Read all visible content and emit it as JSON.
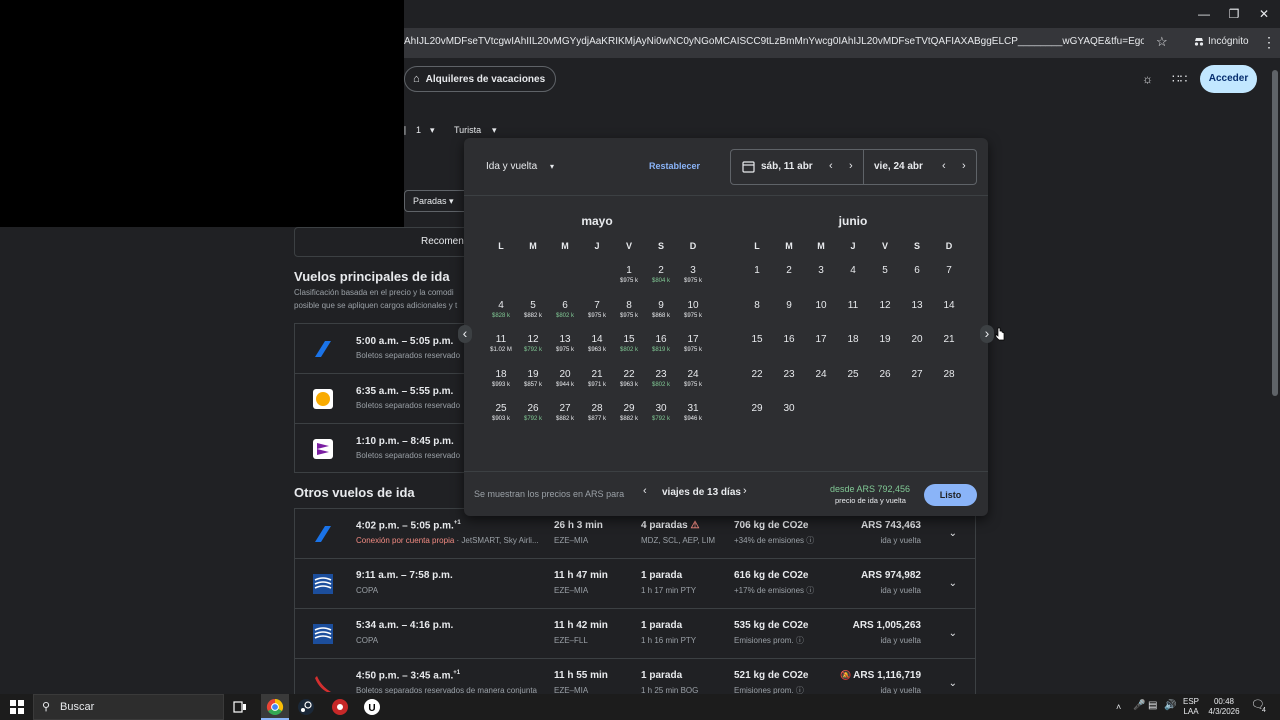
{
  "browser": {
    "url": "AhIJL20vMDFseTVtcgwIAhIIL20vMGYydjAaKRIKMjAyNi0wNC0yNGoMCAISCC9tLzBmMnYwcg0IAhIJL20vMDFseTVtQAFIAXABggELCP________wGYAQE&tfu=EgoIABAAGAAgAigB&...",
    "incognito_label": "Incógnito"
  },
  "header": {
    "chip_label": "Alquileres de vacaciones",
    "signin_label": "Acceder"
  },
  "filters": {
    "passengers": "1",
    "class": "Turista",
    "stops": "Paradas",
    "recommended": "Recomen"
  },
  "top_flights": {
    "title": "Vuelos principales de ida",
    "subtitle_1": "Clasificación basada en el precio y la comodi",
    "subtitle_2": "posible que se apliquen cargos adicionales y t",
    "rows": [
      {
        "time": "5:00 a.m. – 5:05 p.m.",
        "airline": "Boletos separados reservado",
        "logo_color": "#1a73e8"
      },
      {
        "time": "6:35 a.m. – 5:55 p.m.",
        "airline": "Boletos separados reservado",
        "logo_color": "#f9ab00"
      },
      {
        "time": "1:10 p.m. – 8:45 p.m.",
        "airline": "Boletos separados reservado",
        "logo_color": "#7b1fa2"
      }
    ]
  },
  "other_flights": {
    "title": "Otros vuelos de ida",
    "rows": [
      {
        "time": "4:02 p.m. – 5:05 p.m.",
        "plus": "+1",
        "airline": "Conexión por cuenta propia",
        "airline_extra": " · JetSMART, Sky Airli...",
        "duration": "26 h 3 min",
        "route": "EZE–MIA",
        "stops": "4 paradas",
        "stops_detail": "MDZ, SCL, AEP, LIM",
        "co2": "706 kg de CO2e",
        "co2_detail": "+34% de emisiones",
        "price": "ARS 743,463",
        "price_note": "ida y vuelta"
      },
      {
        "time": "9:11 a.m. – 7:58 p.m.",
        "plus": "",
        "airline": "COPA",
        "airline_extra": "",
        "duration": "11 h 47 min",
        "route": "EZE–MIA",
        "stops": "1 parada",
        "stops_detail": "1 h 17 min PTY",
        "co2": "616 kg de CO2e",
        "co2_detail": "+17% de emisiones",
        "price": "ARS 974,982",
        "price_note": "ida y vuelta"
      },
      {
        "time": "5:34 a.m. – 4:16 p.m.",
        "plus": "",
        "airline": "COPA",
        "airline_extra": "",
        "duration": "11 h 42 min",
        "route": "EZE–FLL",
        "stops": "1 parada",
        "stops_detail": "1 h 16 min PTY",
        "co2": "535 kg de CO2e",
        "co2_detail": "Emisiones prom.",
        "price": "ARS 1,005,263",
        "price_note": "ida y vuelta"
      },
      {
        "time": "4:50 p.m. – 3:45 a.m.",
        "plus": "+1",
        "airline": "Boletos separados reservados de manera conjunta",
        "airline_extra": "",
        "duration": "11 h 55 min",
        "route": "EZE–MIA",
        "stops": "1 parada",
        "stops_detail": "1 h 25 min BOG",
        "co2": "521 kg de CO2e",
        "co2_detail": "Emisiones prom.",
        "price": "ARS 1,116,719",
        "price_note": "ida y vuelta"
      }
    ]
  },
  "calendar": {
    "trip_type": "Ida y vuelta",
    "reset_label": "Restablecer",
    "depart_date": "sáb, 11 abr",
    "return_date": "vie, 24 abr",
    "weekdays": [
      "L",
      "M",
      "M",
      "J",
      "V",
      "S",
      "D"
    ],
    "months": [
      {
        "name": "mayo",
        "offset": 4,
        "days": [
          {
            "d": "1",
            "p": "$975 k",
            "low": false
          },
          {
            "d": "2",
            "p": "$804 k",
            "low": true
          },
          {
            "d": "3",
            "p": "$975 k",
            "low": false
          },
          {
            "d": "4",
            "p": "$828 k",
            "low": true
          },
          {
            "d": "5",
            "p": "$882 k",
            "low": false
          },
          {
            "d": "6",
            "p": "$802 k",
            "low": true
          },
          {
            "d": "7",
            "p": "$975 k",
            "low": false
          },
          {
            "d": "8",
            "p": "$975 k",
            "low": false
          },
          {
            "d": "9",
            "p": "$868 k",
            "low": false
          },
          {
            "d": "10",
            "p": "$975 k",
            "low": false
          },
          {
            "d": "11",
            "p": "$1.02 M",
            "low": false
          },
          {
            "d": "12",
            "p": "$792 k",
            "low": true
          },
          {
            "d": "13",
            "p": "$975 k",
            "low": false
          },
          {
            "d": "14",
            "p": "$963 k",
            "low": false
          },
          {
            "d": "15",
            "p": "$802 k",
            "low": true
          },
          {
            "d": "16",
            "p": "$819 k",
            "low": true
          },
          {
            "d": "17",
            "p": "$975 k",
            "low": false
          },
          {
            "d": "18",
            "p": "$993 k",
            "low": false
          },
          {
            "d": "19",
            "p": "$857 k",
            "low": false
          },
          {
            "d": "20",
            "p": "$944 k",
            "low": false
          },
          {
            "d": "21",
            "p": "$971 k",
            "low": false
          },
          {
            "d": "22",
            "p": "$963 k",
            "low": false
          },
          {
            "d": "23",
            "p": "$802 k",
            "low": true
          },
          {
            "d": "24",
            "p": "$975 k",
            "low": false
          },
          {
            "d": "25",
            "p": "$903 k",
            "low": false
          },
          {
            "d": "26",
            "p": "$792 k",
            "low": true
          },
          {
            "d": "27",
            "p": "$882 k",
            "low": false
          },
          {
            "d": "28",
            "p": "$877 k",
            "low": false
          },
          {
            "d": "29",
            "p": "$882 k",
            "low": false
          },
          {
            "d": "30",
            "p": "$792 k",
            "low": true
          },
          {
            "d": "31",
            "p": "$946 k",
            "low": false
          }
        ]
      },
      {
        "name": "junio",
        "offset": 0,
        "days": [
          {
            "d": "1"
          },
          {
            "d": "2"
          },
          {
            "d": "3"
          },
          {
            "d": "4"
          },
          {
            "d": "5"
          },
          {
            "d": "6"
          },
          {
            "d": "7"
          },
          {
            "d": "8"
          },
          {
            "d": "9"
          },
          {
            "d": "10"
          },
          {
            "d": "11"
          },
          {
            "d": "12"
          },
          {
            "d": "13"
          },
          {
            "d": "14"
          },
          {
            "d": "15"
          },
          {
            "d": "16"
          },
          {
            "d": "17"
          },
          {
            "d": "18"
          },
          {
            "d": "19"
          },
          {
            "d": "20"
          },
          {
            "d": "21"
          },
          {
            "d": "22"
          },
          {
            "d": "23"
          },
          {
            "d": "24"
          },
          {
            "d": "25"
          },
          {
            "d": "26"
          },
          {
            "d": "27"
          },
          {
            "d": "28"
          },
          {
            "d": "29"
          },
          {
            "d": "30"
          }
        ]
      }
    ],
    "footer_text": "Se muestran los precios en ARS para",
    "trip_length": "viajes de 13 días",
    "from_price": "desde ARS 792,456",
    "from_note": "precio de ida y vuelta",
    "done_label": "Listo"
  },
  "taskbar": {
    "search_label": "Buscar",
    "lang_1": "ESP",
    "lang_2": "LAA",
    "time": "00:48",
    "date": "4/3/2026",
    "notif_count": "4"
  },
  "colors": {
    "accent_blue": "#8ab4f8",
    "low_price_green": "#81c995"
  }
}
